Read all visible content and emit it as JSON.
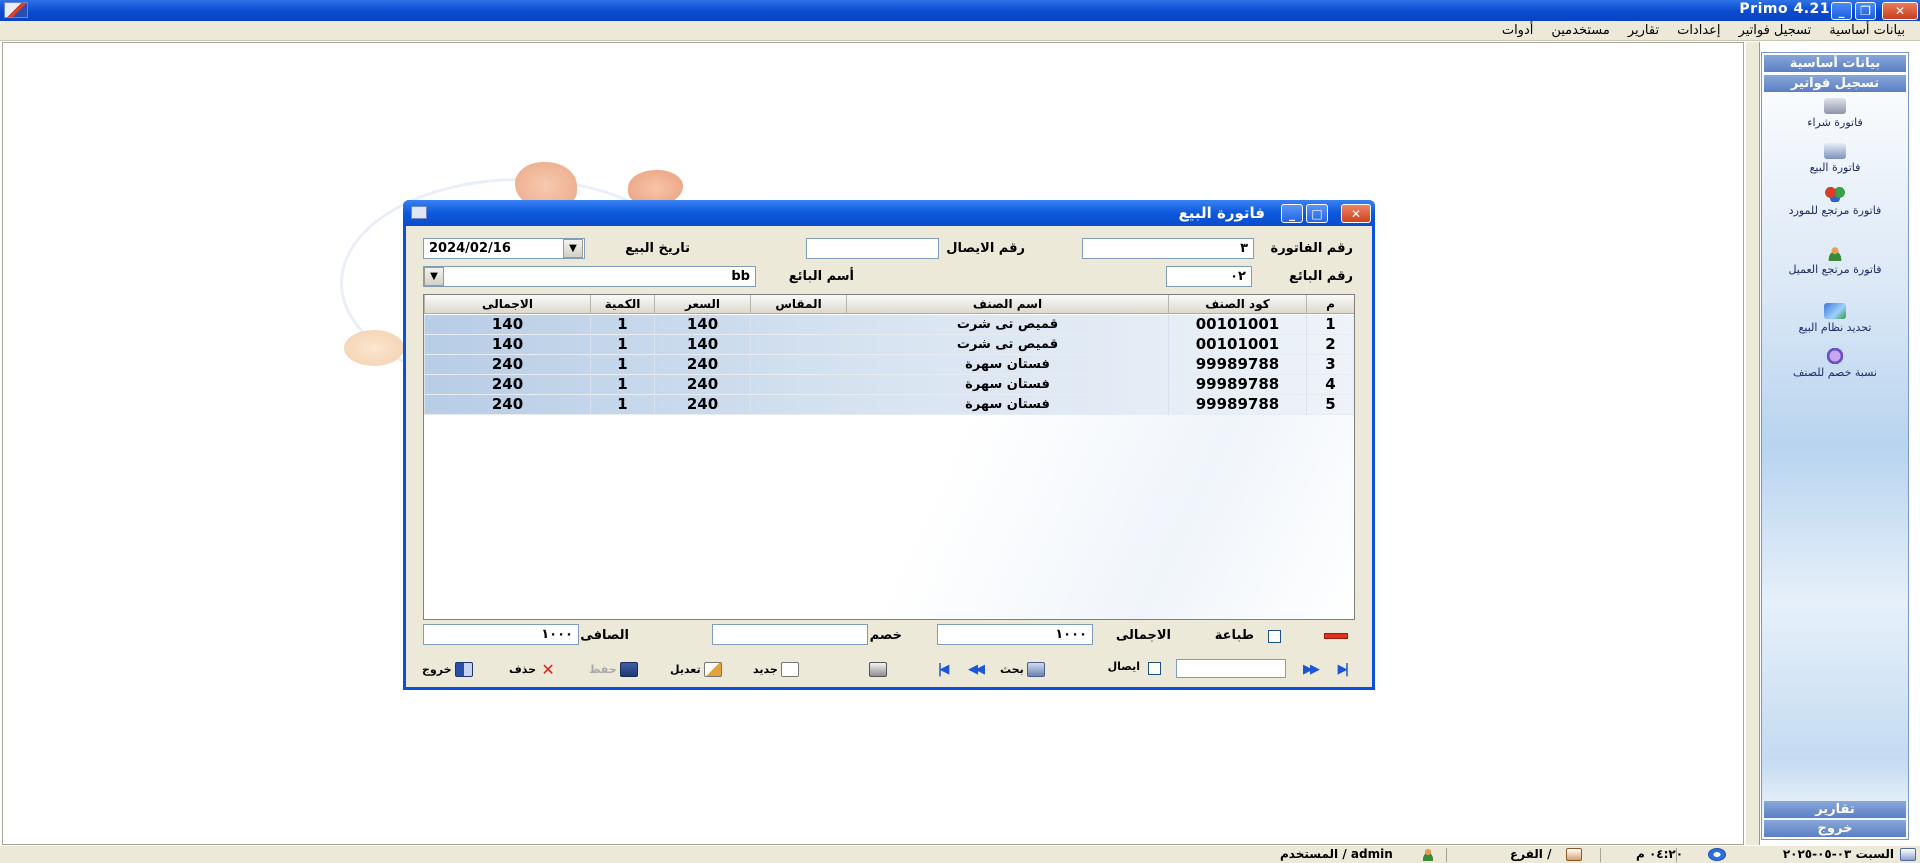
{
  "app": {
    "title": "Primo 4.21"
  },
  "menu": [
    "بيانات أساسية",
    "تسجيل فواتير",
    "إعدادات",
    "تقارير",
    "مستخدمين",
    "أدوات"
  ],
  "side_panel": {
    "header_top": "بيانات أساسية",
    "header_invoices": "تسجيل فواتير",
    "items": [
      "فاتورة شراء",
      "فاتورة البيع",
      "فاتورة مرتجع للمورد",
      "فاتورة مرتجع العميل",
      "تحديد نظام البيع",
      "نسبة خصم للصنف"
    ],
    "footer_reports": "تقارير",
    "footer_exit": "خروج"
  },
  "dialog": {
    "title": "فاتورة البيع",
    "invoice_no_label": "رقم الفاتورة",
    "invoice_no": "٣",
    "receipt_no_label": "رقم الايصال",
    "receipt_no": "",
    "sale_date_label": "تاريخ البيع",
    "sale_date": "2024/02/16",
    "seller_no_label": "رقم البائع",
    "seller_no": "٠٢",
    "seller_name_label": "أسم البائع",
    "seller_name": "bb"
  },
  "grid": {
    "columns": [
      "م",
      "كود الصنف",
      "اسم الصنف",
      "المقاس",
      "السعر",
      "الكمية",
      "الاجمالى"
    ],
    "rows": [
      [
        "1",
        "00101001",
        "قميص تى شرت",
        "",
        "140",
        "1",
        "140"
      ],
      [
        "2",
        "00101001",
        "قميص تى شرت",
        "",
        "140",
        "1",
        "140"
      ],
      [
        "3",
        "99989788",
        "فستان سهرة",
        "",
        "240",
        "1",
        "240"
      ],
      [
        "4",
        "99989788",
        "فستان سهرة",
        "",
        "240",
        "1",
        "240"
      ],
      [
        "5",
        "99989788",
        "فستان سهرة",
        "",
        "240",
        "1",
        "240"
      ]
    ]
  },
  "footer": {
    "print_label": "طباعة",
    "total_label": "الاجمالى",
    "total": "١٠٠٠",
    "discount_label": "خصم",
    "discount": "",
    "net_label": "الصافى",
    "net": "١٠٠٠"
  },
  "toolbar": {
    "receipt_label": "ايصال",
    "search_label": "بحث",
    "new_label": "جديد",
    "edit_label": "تعديل",
    "save_label": "حفظ",
    "delete_label": "حذف",
    "exit_label": "خروج",
    "search_value": ""
  },
  "status_bar": {
    "date": "السبت ٠٣-٠٥-٢٠٢٥",
    "time": "٠٤:٢٠ م",
    "branch": "الفرع /",
    "user": "المستخدم / admin"
  },
  "colors": {
    "titlebar": "#0a4ad0",
    "dialog_border": "#0b50d8",
    "grid_row": "#b7cde6",
    "panel": "#b8d4ef"
  }
}
